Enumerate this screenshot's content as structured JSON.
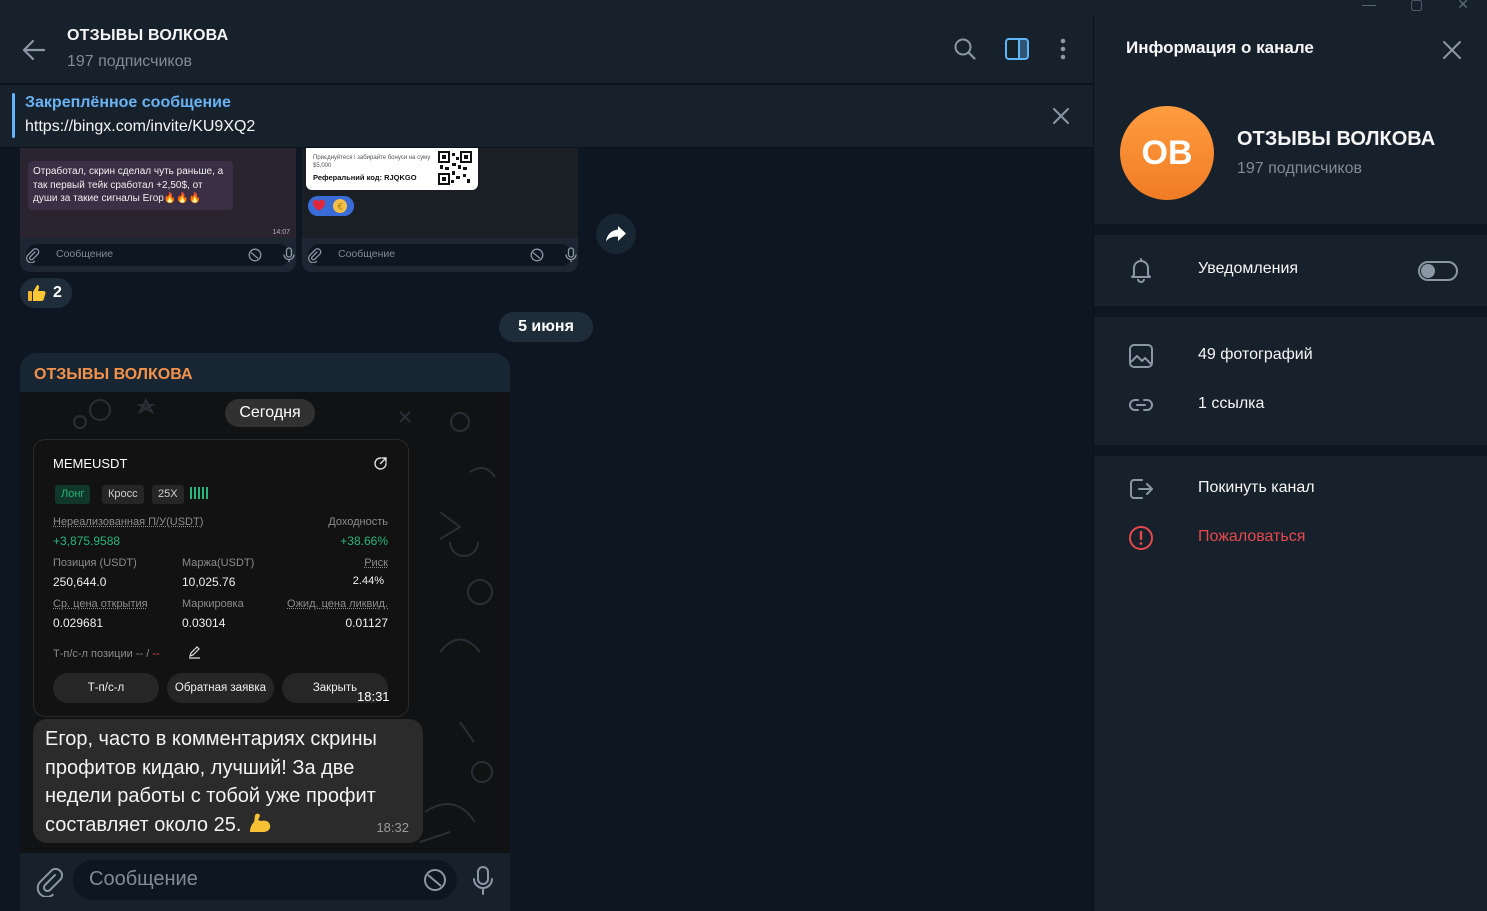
{
  "chat": {
    "title": "ОТЗЫВЫ ВОЛКОВА",
    "subscribers": "197 подписчиков",
    "pinned": {
      "title": "Закреплённое сообщение",
      "link": "https://bingx.com/invite/KU9XQ2"
    },
    "thumb1": {
      "caption": "Отработал, скрин сделал чуть раньше, а так первый тейк сработал +2,50$, от души за такие сигналы Егор🔥🔥🔥",
      "time": "14:07",
      "input_placeholder": "Сообщение"
    },
    "thumb2": {
      "ref_text": "Приєднуйтеся і забирайте бонуси на суму $5,000",
      "ref_code": "Реферальний код: RJQKGO",
      "input_placeholder": "Сообщение"
    },
    "reaction": {
      "emoji": "thumbs-up",
      "count": "2"
    },
    "date_separator": "5 июня",
    "message": {
      "author": "ОТЗЫВЫ ВОЛКОВА",
      "photo_date_chip": "Сегодня",
      "trade": {
        "symbol": "MEMEUSDT",
        "tags": [
          "Лонг",
          "Кросс",
          "25X"
        ],
        "pnl_label": "Нереализованная П/У(USDT)",
        "pnl_value": "+3,875.9588",
        "yield_label": "Доходность",
        "yield_value": "+38.66%",
        "position_label": "Позиция (USDT)",
        "position_value": "250,644.0",
        "margin_label": "Маржа(USDT)",
        "margin_value": "10,025.76",
        "risk_label": "Риск",
        "risk_value": "2.44%",
        "avg_open_label": "Ср. цена открытия",
        "avg_open_value": "0.029681",
        "mark_label": "Маркировка",
        "mark_value": "0.03014",
        "liq_label": "Ожид. цена ликвид.",
        "liq_value": "0.01127",
        "tpsl_label": "Т-п/с-л позиции",
        "tpsl_value_a": "--",
        "tpsl_sep": "/",
        "tpsl_value_b": "--",
        "btn_tpsl": "Т-п/с-л",
        "btn_reverse": "Обратная заявка",
        "btn_close": "Закрыть",
        "time": "18:31"
      },
      "text": "Егор, часто в комментариях скрины профитов кидаю, лучший! За две недели работы с тобой уже профит составляет около 25.",
      "text_time": "18:32"
    },
    "input_placeholder": "Сообщение"
  },
  "info": {
    "title": "Информация о канале",
    "avatar_initials": "OB",
    "avatar_color": "#f5862e",
    "name": "ОТЗЫВЫ ВОЛКОВА",
    "subscribers": "197 подписчиков",
    "notifications": "Уведомления",
    "notifications_on": false,
    "photos": "49 фотографий",
    "links": "1 ссылка",
    "leave": "Покинуть канал",
    "report": "Пожаловаться"
  },
  "colors": {
    "accent": "#6ab3f3",
    "author": "#f3924a",
    "danger": "#e5484d",
    "profit": "#26b47d"
  }
}
